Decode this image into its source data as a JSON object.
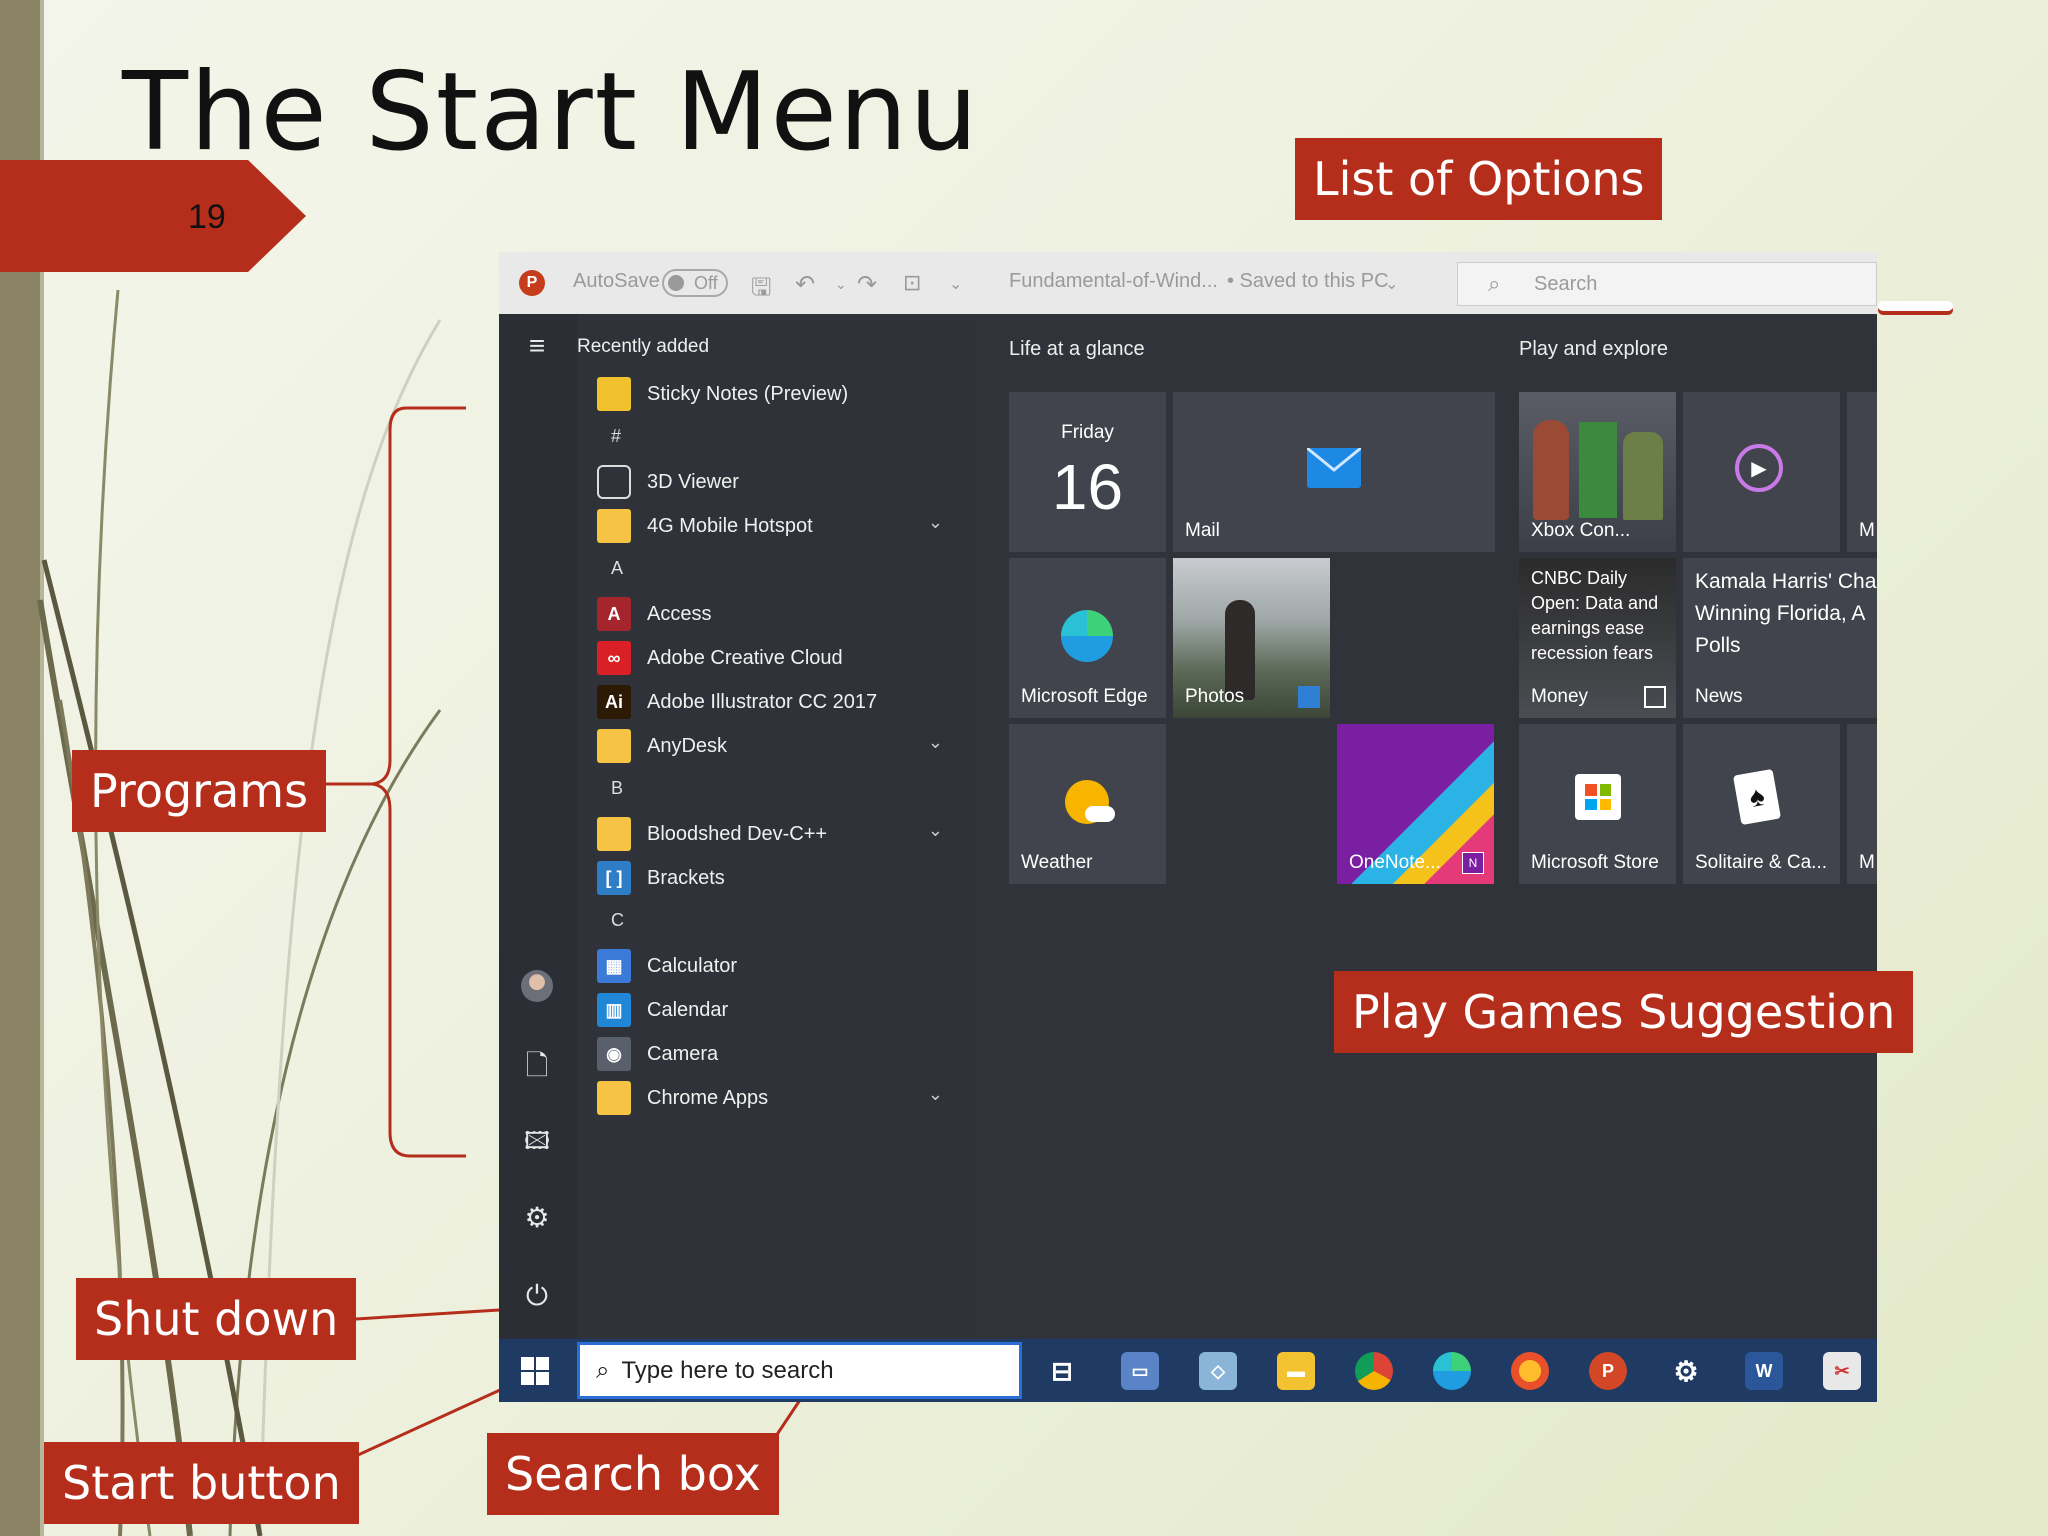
{
  "slide": {
    "title": "The Start Menu",
    "number": "19"
  },
  "callouts": {
    "list_of_options": "List of Options",
    "programs": "Programs",
    "play_games": "Play Games Suggestion",
    "shut_down": "Shut down",
    "start_button": "Start button",
    "search_box": "Search box"
  },
  "titlebar": {
    "autosave": "AutoSave",
    "toggle": "Off",
    "filename": "Fundamental-of-Wind...",
    "saved": "• Saved to this PC",
    "search_placeholder": "Search"
  },
  "app_list": {
    "recently_added": "Recently added",
    "items": [
      {
        "type": "app",
        "label": "Sticky Notes (Preview)",
        "icon": "sticky-notes-icon",
        "color": "#f2c12e"
      },
      {
        "type": "header",
        "label": "#"
      },
      {
        "type": "app",
        "label": "3D Viewer",
        "icon": "cube-icon",
        "color": "transparent"
      },
      {
        "type": "app",
        "label": "4G Mobile Hotspot",
        "icon": "folder-icon",
        "color": "#f6c344",
        "chevron": true
      },
      {
        "type": "header",
        "label": "A"
      },
      {
        "type": "app",
        "label": "Access",
        "icon": "access-icon",
        "color": "#a4262c",
        "glyph": "A"
      },
      {
        "type": "app",
        "label": "Adobe Creative Cloud",
        "icon": "creative-cloud-icon",
        "color": "#da1f26",
        "glyph": "∞"
      },
      {
        "type": "app",
        "label": "Adobe Illustrator CC 2017",
        "icon": "illustrator-icon",
        "color": "#2d1a05",
        "glyph": "Ai"
      },
      {
        "type": "app",
        "label": "AnyDesk",
        "icon": "folder-icon",
        "color": "#f6c344",
        "chevron": true
      },
      {
        "type": "header",
        "label": "B"
      },
      {
        "type": "app",
        "label": "Bloodshed Dev-C++",
        "icon": "folder-icon",
        "color": "#f6c344",
        "chevron": true
      },
      {
        "type": "app",
        "label": "Brackets",
        "icon": "brackets-icon",
        "color": "#2d7ec7",
        "glyph": "[ ]"
      },
      {
        "type": "header",
        "label": "C"
      },
      {
        "type": "app",
        "label": "Calculator",
        "icon": "calculator-icon",
        "color": "#3b7ad6",
        "glyph": "▦"
      },
      {
        "type": "app",
        "label": "Calendar",
        "icon": "calendar-icon",
        "color": "#1f87d6",
        "glyph": "▥"
      },
      {
        "type": "app",
        "label": "Camera",
        "icon": "camera-icon",
        "color": "#5a5f6c",
        "glyph": "◉"
      },
      {
        "type": "app",
        "label": "Chrome Apps",
        "icon": "folder-icon",
        "color": "#f6c344",
        "chevron": true
      }
    ]
  },
  "tiles": {
    "life_title": "Life at a glance",
    "play_title": "Play and explore",
    "calendar_day": "Friday",
    "calendar_date": "16",
    "mail": "Mail",
    "edge": "Microsoft Edge",
    "photos": "Photos",
    "weather": "Weather",
    "onenote": "OneNote...",
    "xbox": "Xbox Con...",
    "money_headline": "CNBC Daily Open: Data and earnings ease recession fears",
    "money": "Money",
    "news_headline": "Kamala Harris' Cha Winning Florida, A Polls",
    "news": "News",
    "store": "Microsoft Store",
    "solitaire": "Solitaire & Ca...",
    "cut_label_1": "M",
    "cut_label_2": "M"
  },
  "taskbar": {
    "search_placeholder": "Type here to search"
  }
}
